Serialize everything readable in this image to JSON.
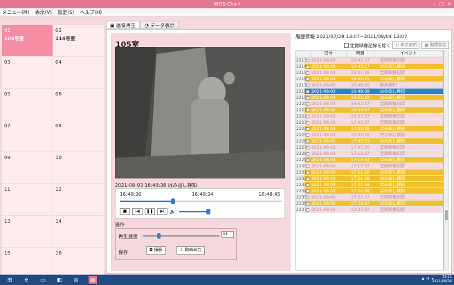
{
  "window": {
    "title": "WOS-Chart",
    "controls": [
      "–",
      "□",
      "✕"
    ]
  },
  "menu": [
    {
      "label": "メニュー(M)"
    },
    {
      "label": "表示(V)"
    },
    {
      "label": "設定(S)"
    },
    {
      "label": "ヘルプ(H)"
    }
  ],
  "rooms": [
    {
      "no": "01",
      "name": "105号室",
      "selected": true
    },
    {
      "no": "02",
      "name": "114号室",
      "selected": false
    },
    {
      "no": "03",
      "name": ""
    },
    {
      "no": "04",
      "name": ""
    },
    {
      "no": "05",
      "name": ""
    },
    {
      "no": "06",
      "name": ""
    },
    {
      "no": "07",
      "name": ""
    },
    {
      "no": "08",
      "name": ""
    },
    {
      "no": "09",
      "name": ""
    },
    {
      "no": "10",
      "name": ""
    },
    {
      "no": "11",
      "name": ""
    },
    {
      "no": "12",
      "name": ""
    },
    {
      "no": "13",
      "name": ""
    },
    {
      "no": "14",
      "name": ""
    },
    {
      "no": "15",
      "name": ""
    },
    {
      "no": "16",
      "name": ""
    }
  ],
  "tabs": [
    {
      "label": "画像再生",
      "active": true
    },
    {
      "label": "データ表示",
      "active": false
    }
  ],
  "player": {
    "room_title": "105室",
    "caption": "2021-08-03 16:48:38 はみ出し検知",
    "time_start": "16:48:30",
    "time_mid": "16:48:34",
    "time_end": "16:48:45",
    "seek_progress": 0.33,
    "volume_level": 1.0
  },
  "ops": {
    "label": "操作",
    "speed_label": "再生速度",
    "speed_value": "x1",
    "speed_level": 0.2,
    "save_label": "保存",
    "snapshot_label": "撮影",
    "export_label": "動画出力"
  },
  "history": {
    "title": "履歴情報 2021/07/28 13:07~2021/08/04 13:07",
    "exclude_label": "定期映像記録を除く",
    "refresh_label": "表示更新",
    "period_label": "期間指定",
    "columns": [
      "日付",
      "時間",
      "イベント"
    ],
    "rows": [
      {
        "no": "2213",
        "date": "2021-08-03",
        "time": "16:42:37",
        "event": "定期映像記録",
        "style": "plain"
      },
      {
        "no": "2214",
        "date": "2021-08-03",
        "time": "16:43:17",
        "event": "はみ出し検知",
        "style": "warn"
      },
      {
        "no": "2215",
        "date": "2021-08-03",
        "time": "16:47:36",
        "event": "定期映像記録",
        "style": "plain"
      },
      {
        "no": "2216",
        "date": "2021-08-03",
        "time": "16:48:25",
        "event": "はみ出し検知",
        "style": "warn"
      },
      {
        "no": "2217",
        "date": "2021-08-03",
        "time": "16:48:26",
        "event": "離床検知",
        "style": "plain"
      },
      {
        "no": "2218",
        "date": "2021-08-03",
        "time": "16:48:38",
        "event": "はみ出し検知",
        "style": "sel"
      },
      {
        "no": "2219",
        "date": "2021-08-03",
        "time": "16:51:20",
        "event": "はみ出し検知",
        "style": "warn"
      },
      {
        "no": "2220",
        "date": "2021-08-03",
        "time": "16:52:37",
        "event": "定期映像記録",
        "style": "plain"
      },
      {
        "no": "2221",
        "date": "2021-08-02",
        "time": "16:53:07",
        "event": "はみ出し検知",
        "style": "warn"
      },
      {
        "no": "2222",
        "date": "2021-08-03",
        "time": "16:57:37",
        "event": "定期映像記録",
        "style": "plain"
      },
      {
        "no": "2223",
        "date": "2021-08-03",
        "time": "17:02:37",
        "event": "定期映像記録",
        "style": "plain"
      },
      {
        "no": "2224",
        "date": "2021-08-03",
        "time": "17:03:38",
        "event": "はみ出し検知",
        "style": "warn"
      },
      {
        "no": "2225",
        "date": "2021-08-03",
        "time": "17:05:16",
        "event": "呼び出し検知",
        "style": "plain"
      },
      {
        "no": "2226",
        "date": "2021-08-03",
        "time": "17:07:15",
        "event": "はみ出し検知",
        "style": "warn"
      },
      {
        "no": "2227",
        "date": "2021-08-03",
        "time": "17:07:36",
        "event": "定期映像記録",
        "style": "plain"
      },
      {
        "no": "2228",
        "date": "2021-08-03",
        "time": "17:12:37",
        "event": "定期映像記録",
        "style": "plain"
      },
      {
        "no": "2229",
        "date": "2021-08-03",
        "time": "17:15:02",
        "event": "はみ出し検知",
        "style": "warn"
      },
      {
        "no": "2230",
        "date": "2021-08-03",
        "time": "17:17:37",
        "event": "定期映像記録",
        "style": "plain"
      },
      {
        "no": "2231",
        "date": "2021-08-03",
        "time": "17:21:26",
        "event": "はみ出し検知",
        "style": "warn"
      },
      {
        "no": "2232",
        "date": "2021-08-03",
        "time": "17:21:38",
        "event": "はみ出し検知",
        "style": "warn"
      },
      {
        "no": "2233",
        "date": "2021-08-03",
        "time": "17:21:56",
        "event": "はみ出し検知",
        "style": "warn"
      },
      {
        "no": "2234",
        "date": "2021-08-03",
        "time": "17:22:08",
        "event": "はみ出し検知",
        "style": "warn"
      },
      {
        "no": "2235",
        "date": "2021-08-03",
        "time": "17:22:37",
        "event": "定期映像記録",
        "style": "plain"
      },
      {
        "no": "2236",
        "date": "2021-08-03",
        "time": "17:24:07",
        "event": "はみ出し検知",
        "style": "warn"
      },
      {
        "no": "2237",
        "date": "2021-08-03",
        "time": "17:27:37",
        "event": "定期映像記録",
        "style": "plain"
      }
    ]
  },
  "taskbar": {
    "clock_time": "13:11",
    "clock_date": "2021/08/04"
  },
  "colors": {
    "accent_pink": "#e3758f",
    "selected_room": "#f58ea4",
    "panel_bg": "#f5d9dc",
    "warn_row": "#f0c030",
    "selected_row": "#2e83c8",
    "taskbar": "#1f4a82"
  }
}
